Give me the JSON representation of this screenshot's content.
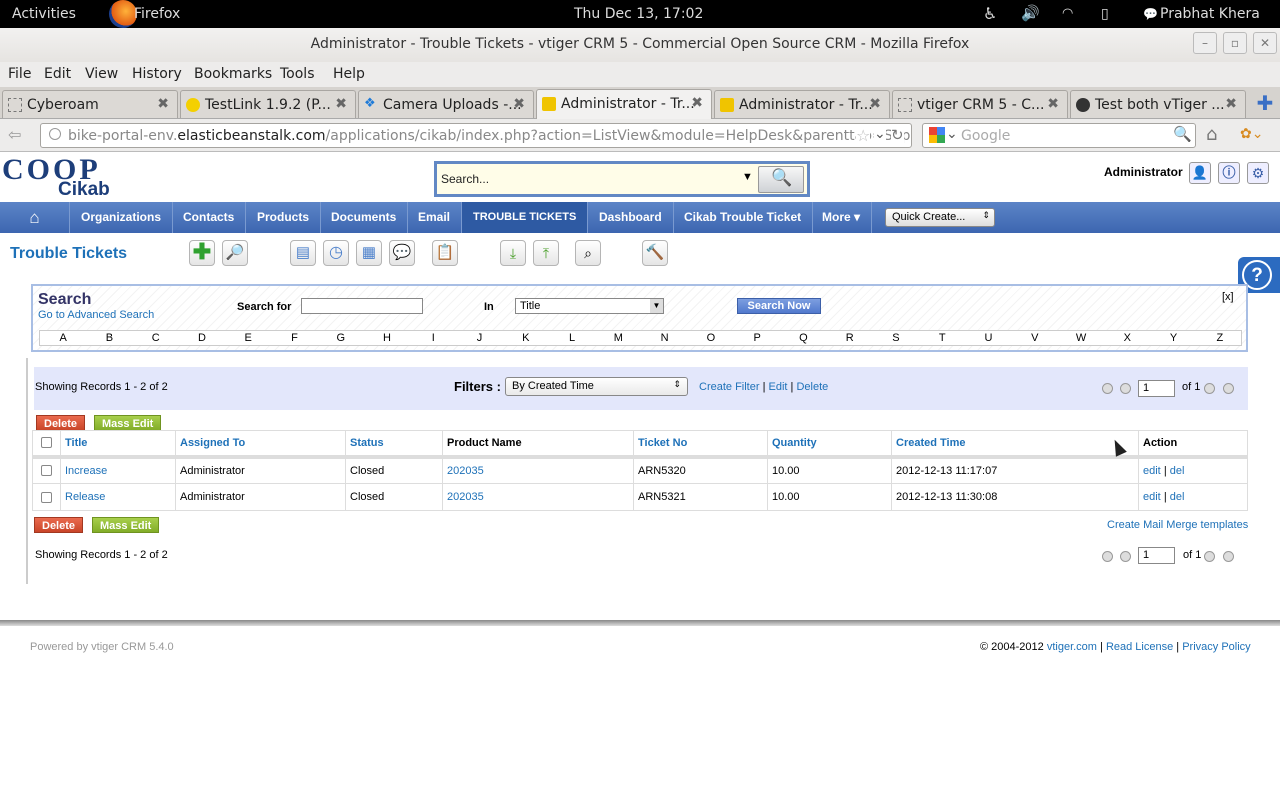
{
  "system_bar": {
    "activities": "Activities",
    "app": "Firefox",
    "clock": "Thu Dec 13, 17:02",
    "user": "Prabhat Khera"
  },
  "window": {
    "title": "Administrator - Trouble Tickets - vtiger CRM 5 - Commercial Open Source CRM - Mozilla Firefox"
  },
  "menu": [
    "File",
    "Edit",
    "View",
    "History",
    "Bookmarks",
    "Tools",
    "Help"
  ],
  "tabs": [
    {
      "label": "Cyberoam"
    },
    {
      "label": "TestLink 1.9.2 (P..."
    },
    {
      "label": "Camera Uploads -..."
    },
    {
      "label": "Administrator - Tr..."
    },
    {
      "label": "Administrator - Tr..."
    },
    {
      "label": "vtiger CRM 5 - C..."
    },
    {
      "label": "Test both vTiger ..."
    }
  ],
  "url": {
    "pre": "bike-portal-env.",
    "host": "elasticbeanstalk.com",
    "path": "/applications/cikab/index.php?action=ListView&module=HelpDesk&parenttab=Sup"
  },
  "search_engine": {
    "placeholder": "Google"
  },
  "crm": {
    "logo_top": "COOP",
    "logo_bottom": "Cikab",
    "search_placeholder": "Search...",
    "user": "Administrator",
    "nav": [
      "Organizations",
      "Contacts",
      "Products",
      "Documents",
      "Email",
      "TROUBLE TICKETS",
      "Dashboard",
      "Cikab Trouble Ticket",
      "More"
    ],
    "quick_create": "Quick Create...",
    "page_title": "Trouble Tickets",
    "search": {
      "heading": "Search",
      "advanced": "Go to Advanced Search",
      "search_for": "Search for",
      "in": "In",
      "field": "Title",
      "button": "Search Now",
      "close": "[x]",
      "letters": [
        "A",
        "B",
        "C",
        "D",
        "E",
        "F",
        "G",
        "H",
        "I",
        "J",
        "K",
        "L",
        "M",
        "N",
        "O",
        "P",
        "Q",
        "R",
        "S",
        "T",
        "U",
        "V",
        "W",
        "X",
        "Y",
        "Z"
      ]
    },
    "list": {
      "showing": "Showing Records 1 - 2 of 2",
      "filters_label": "Filters :",
      "filter_value": "By Created Time",
      "create_filter": "Create Filter",
      "edit": "Edit",
      "delete_link": "Delete",
      "sep": "|",
      "page": "1",
      "of": "of 1",
      "delete_btn": "Delete",
      "mass_edit_btn": "Mass Edit",
      "columns": [
        "Title",
        "Assigned To",
        "Status",
        "Product Name",
        "Ticket No",
        "Quantity",
        "Created Time",
        "Action"
      ],
      "rows": [
        {
          "title": "Increase",
          "assigned": "Administrator",
          "status": "Closed",
          "product": "202035",
          "ticket": "ARN5320",
          "qty": "10.00",
          "created": "2012-12-13 11:17:07",
          "edit": "edit",
          "del": "del"
        },
        {
          "title": "Release",
          "assigned": "Administrator",
          "status": "Closed",
          "product": "202035",
          "ticket": "ARN5321",
          "qty": "10.00",
          "created": "2012-12-13 11:30:08",
          "edit": "edit",
          "del": "del"
        }
      ],
      "mail_merge": "Create Mail Merge templates"
    },
    "footer": {
      "powered": "Powered by vtiger CRM 5.4.0",
      "copy": "© 2004-2012",
      "vtiger": "vtiger.com",
      "license": "Read License",
      "privacy": "Privacy Policy"
    }
  }
}
